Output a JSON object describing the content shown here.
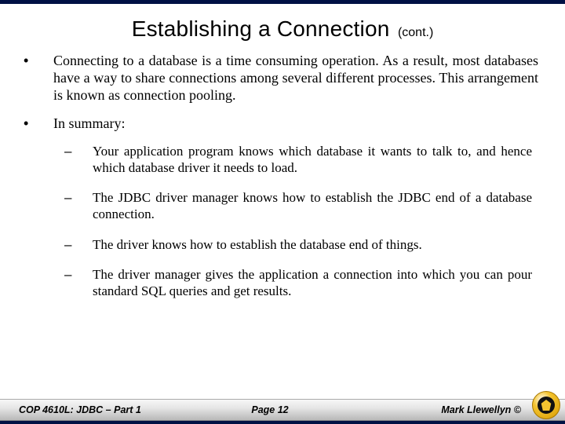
{
  "title": {
    "main": "Establishing a Connection",
    "cont": "(cont.)"
  },
  "bullets": [
    {
      "text": "Connecting to a database is a time consuming operation.  As a result, most databases have a way to share connections among several different processes.  This arrangement is known as connection pooling."
    },
    {
      "text": "In summary:"
    }
  ],
  "subbullets": [
    "Your application program knows which database it wants to talk to, and hence which database driver it needs to load.",
    "The JDBC driver manager knows how to establish the JDBC end of a database connection.",
    "The driver knows how to establish the database end of things.",
    "The driver manager gives the application a connection into which you can pour standard SQL queries and get results."
  ],
  "footer": {
    "left": "COP 4610L: JDBC – Part 1",
    "center": "Page 12",
    "right": "Mark Llewellyn ©"
  }
}
